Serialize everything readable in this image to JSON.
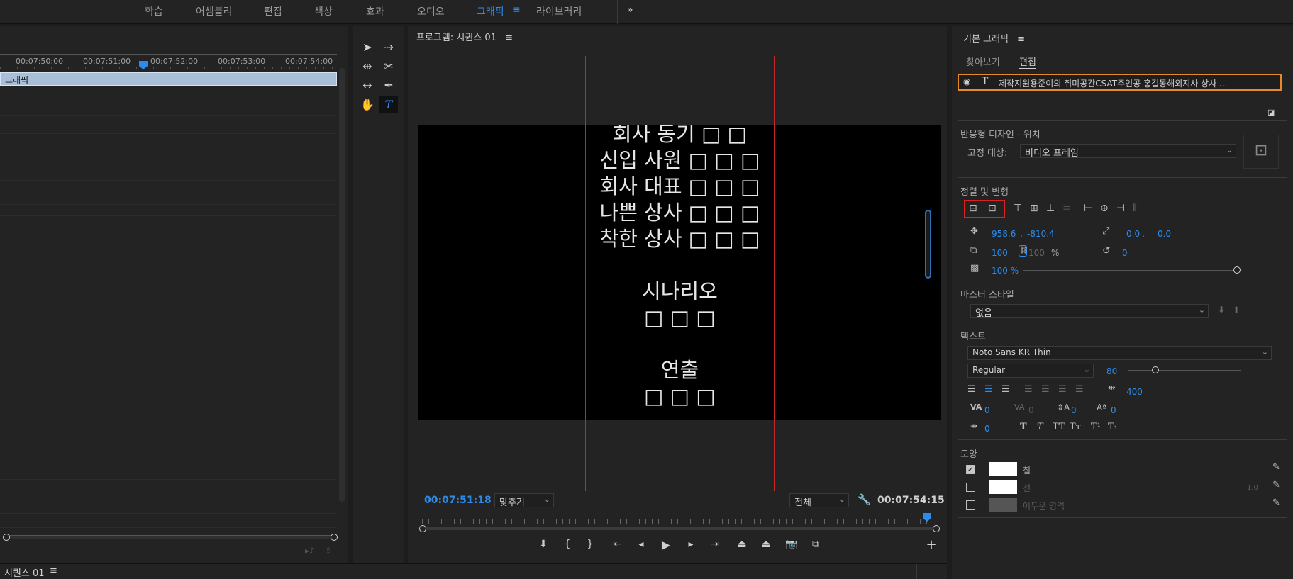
{
  "workspace_tabs": [
    "학습",
    "어셈블리",
    "편집",
    "색상",
    "효과",
    "오디오",
    "그래픽",
    "라이브러리"
  ],
  "workspace_active": "그래픽",
  "workspace_more": "»",
  "timeline": {
    "ruler_labels": [
      "00:07:50:00",
      "00:07:51:00",
      "00:07:52:00",
      "00:07:53:00",
      "00:07:54:00"
    ],
    "clip_label": "그래픽"
  },
  "sequence_tab": {
    "label": "시퀀스 01",
    "menu": "≡"
  },
  "program": {
    "title": "프로그램: 시퀀스 01",
    "menu": "≡",
    "credits": {
      "lines1": [
        "회사 동기 □ □",
        "신입 사원 □ □ □",
        "회사 대표 □ □ □",
        "나쁜 상사 □ □ □",
        "착한 상사 □ □ □"
      ],
      "heading2": "시나리오",
      "line2": "□ □ □",
      "heading3": "연출",
      "line3": "□ □ □"
    },
    "timecode_current": "00:07:51:18",
    "fit_label": "맞추기",
    "resolution_label": "전체",
    "timecode_duration": "00:07:54:15"
  },
  "egp": {
    "title": "기본 그래픽",
    "menu": "≡",
    "tabs": [
      "찾아보기",
      "편집"
    ],
    "active_tab": "편집",
    "layer_name": "제작지원용준이의 취미공간CSAT주인공 홍길동해외지사 상사 ...",
    "responsive_title": "반응형 디자인 - 위치",
    "pin_label": "고정 대상:",
    "pin_value": "비디오 프레임",
    "align_title": "정렬 및 변형",
    "position_x": "958.6",
    "position_y": "-810.4",
    "anchor_x": "0.0",
    "anchor_y": "0.0",
    "scale": "100",
    "scale_linked": "100",
    "scale_unit": "%",
    "rotation": "0",
    "opacity": "100 %",
    "master_title": "마스터 스타일",
    "master_value": "없음",
    "text_title": "텍스트",
    "font_family": "Noto Sans KR Thin",
    "font_style": "Regular",
    "font_size": "80",
    "tracking_value": "400",
    "kerning": "0",
    "tracking": "0",
    "leading": "0",
    "baseline": "0",
    "tsume": "0",
    "style_buttons": [
      "T",
      "T",
      "TT",
      "Tт",
      "T¹",
      "T₁"
    ],
    "appearance_title": "모양",
    "fill_label": "칠",
    "stroke_label": "선",
    "stroke_width": "1.0",
    "shadow_label": "어두운 영역"
  },
  "colors": {
    "accent": "#2d8ceb",
    "selection_orange": "#e8892b",
    "highlight_red": "#e02020",
    "guide_red": "#c62828"
  }
}
